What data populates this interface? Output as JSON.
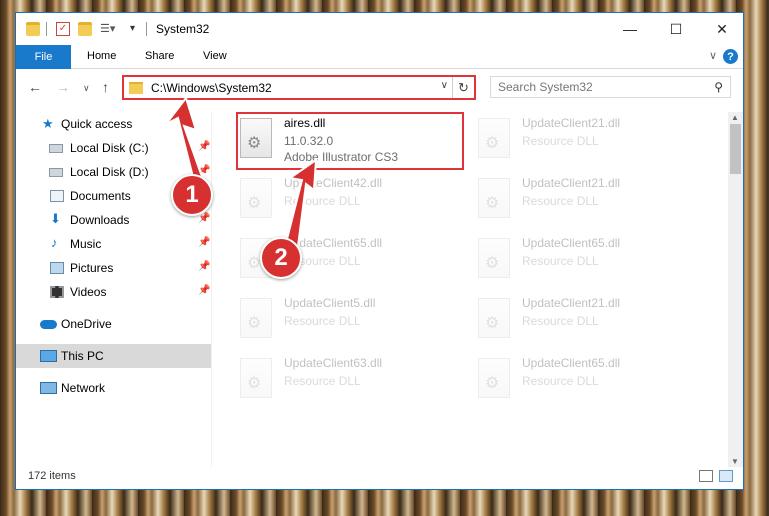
{
  "window": {
    "title": "System32",
    "controls": {
      "minimize": "—",
      "maximize": "☐",
      "close": "✕"
    }
  },
  "ribbon": {
    "tabs": [
      "File",
      "Home",
      "Share",
      "View"
    ],
    "help": "?"
  },
  "address_bar": {
    "path": "C:\\Windows\\System32",
    "refresh_icon": "refresh-icon"
  },
  "search": {
    "placeholder": "Search System32"
  },
  "nav_pane": {
    "items": [
      {
        "label": "Quick access",
        "icon": "star-icon",
        "pinned": false
      },
      {
        "label": "Local Disk (C:)",
        "icon": "drive-icon",
        "pinned": true
      },
      {
        "label": "Local Disk (D:)",
        "icon": "drive-icon",
        "pinned": true
      },
      {
        "label": "Documents",
        "icon": "documents-icon",
        "pinned": true
      },
      {
        "label": "Downloads",
        "icon": "download-icon",
        "pinned": true
      },
      {
        "label": "Music",
        "icon": "music-icon",
        "pinned": true
      },
      {
        "label": "Pictures",
        "icon": "pictures-icon",
        "pinned": true
      },
      {
        "label": "Videos",
        "icon": "videos-icon",
        "pinned": true
      },
      {
        "label": "OneDrive",
        "icon": "onedrive-icon",
        "pinned": false
      },
      {
        "label": "This PC",
        "icon": "computer-icon",
        "pinned": false,
        "selected": true
      },
      {
        "label": "Network",
        "icon": "network-icon",
        "pinned": false
      }
    ]
  },
  "files": {
    "highlighted": {
      "name": "aires.dll",
      "version": "11.0.32.0",
      "company": "Adobe Illustrator CS3"
    },
    "faded": [
      {
        "name": "UpdateClient21.dll",
        "desc": "Resource DLL"
      },
      {
        "name": "UpdateClient42.dll",
        "desc": "Resource DLL"
      },
      {
        "name": "UpdateClient21.dll",
        "desc": "Resource DLL"
      },
      {
        "name": "UpdateClient65.dll",
        "desc": "Resource DLL"
      },
      {
        "name": "UpdateClient65.dll",
        "desc": "Resource DLL"
      },
      {
        "name": "UpdateClient5.dll",
        "desc": "Resource DLL"
      },
      {
        "name": "UpdateClient21.dll",
        "desc": "Resource DLL"
      },
      {
        "name": "UpdateClient63.dll",
        "desc": "Resource DLL"
      },
      {
        "name": "UpdateClient65.dll",
        "desc": "Resource DLL"
      }
    ]
  },
  "status_bar": {
    "item_count": "172 items"
  },
  "callouts": [
    "1",
    "2"
  ],
  "colors": {
    "accent": "#1979ca",
    "highlight": "#e0333a",
    "callout": "#d63031"
  }
}
